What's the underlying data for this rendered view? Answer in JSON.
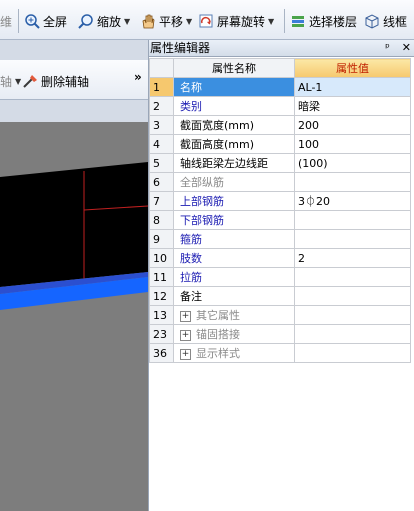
{
  "toolbar": {
    "partial_left": "维",
    "fullscreen": "全屏",
    "zoom": "缩放",
    "pan": "平移",
    "rotate": "屏幕旋转",
    "select_floor": "选择楼层",
    "wireframe": "线框"
  },
  "left_toolbar": {
    "partial_label": "轴",
    "delete_aux_axis": "删除辅轴",
    "more": "»"
  },
  "panel": {
    "title": "属性编辑器",
    "pin": "ᵖ",
    "close": "✕",
    "header_name": "属性名称",
    "header_value": "属性值",
    "rows": [
      {
        "idx": "1",
        "name": "名称",
        "value": "AL-1",
        "style": "blue",
        "selected": true
      },
      {
        "idx": "2",
        "name": "类别",
        "value": "暗梁",
        "style": "blue"
      },
      {
        "idx": "3",
        "name": "截面宽度(mm)",
        "value": "200",
        "style": "black"
      },
      {
        "idx": "4",
        "name": "截面高度(mm)",
        "value": "100",
        "style": "black"
      },
      {
        "idx": "5",
        "name": "轴线距梁左边线距",
        "value": "(100)",
        "style": "black"
      },
      {
        "idx": "6",
        "name": "全部纵筋",
        "value": "",
        "style": "gray"
      },
      {
        "idx": "7",
        "name": "上部钢筋",
        "value": "3⏀20",
        "style": "blue"
      },
      {
        "idx": "8",
        "name": "下部钢筋",
        "value": "",
        "style": "blue"
      },
      {
        "idx": "9",
        "name": "箍筋",
        "value": "",
        "style": "blue"
      },
      {
        "idx": "10",
        "name": "肢数",
        "value": "2",
        "style": "blue"
      },
      {
        "idx": "11",
        "name": "拉筋",
        "value": "",
        "style": "blue"
      },
      {
        "idx": "12",
        "name": "备注",
        "value": "",
        "style": "black"
      },
      {
        "idx": "13",
        "name": "其它属性",
        "value": "",
        "style": "gray",
        "expand": true
      },
      {
        "idx": "23",
        "name": "锚固搭接",
        "value": "",
        "style": "gray",
        "expand": true
      },
      {
        "idx": "36",
        "name": "显示样式",
        "value": "",
        "style": "gray",
        "expand": true
      }
    ]
  }
}
